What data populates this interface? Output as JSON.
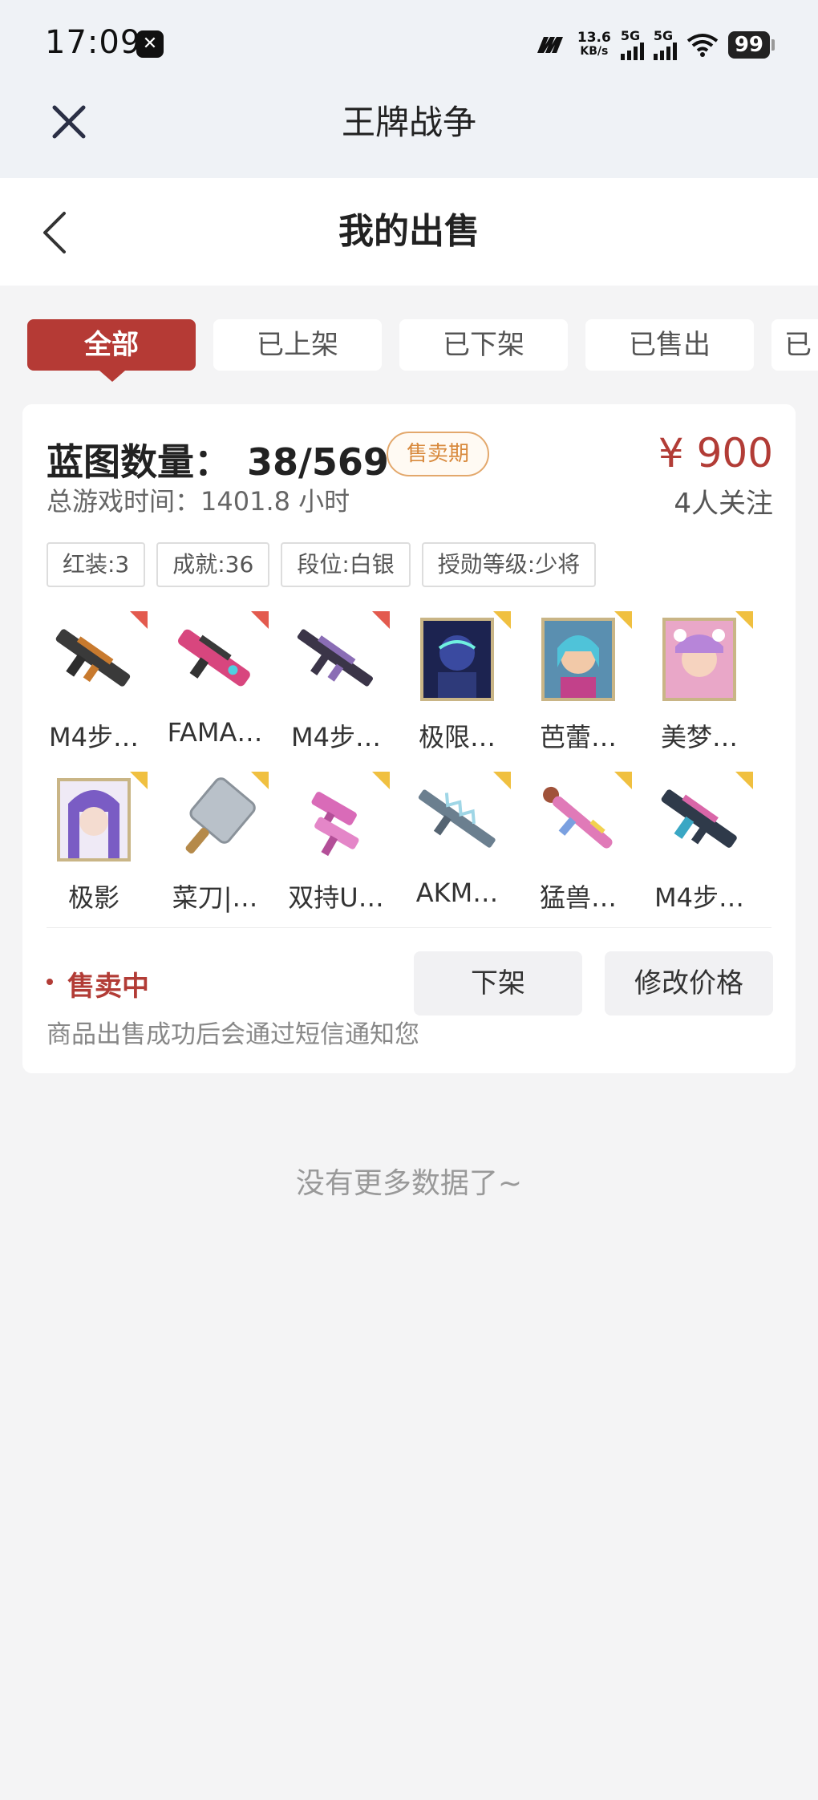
{
  "status_bar": {
    "time": "17:09",
    "net_speed_value": "13.6",
    "net_speed_unit": "KB/s",
    "sim1_label": "5G",
    "sim2_label": "5G",
    "battery": "99"
  },
  "top_bar": {
    "title": "王牌战争"
  },
  "nav": {
    "title": "我的出售"
  },
  "tabs": [
    {
      "label": "全部",
      "active": true
    },
    {
      "label": "已上架"
    },
    {
      "label": "已下架"
    },
    {
      "label": "已售出"
    },
    {
      "label": "已"
    }
  ],
  "listing": {
    "blueprint_label": "蓝图数量：",
    "blueprint_count": "38/569",
    "status_badge": "售卖期",
    "price": "¥ 900",
    "followers": "4人关注",
    "playtime": "总游戏时间：1401.8 小时",
    "tags": [
      "红装:3",
      "成就:36",
      "段位:白银",
      "授勋等级:少将"
    ],
    "items": [
      {
        "name": "M4步…",
        "icon": "rifle-icon",
        "rarity": "red"
      },
      {
        "name": "FAMA…",
        "icon": "rifle-icon",
        "rarity": "red"
      },
      {
        "name": "M4步…",
        "icon": "rifle-icon",
        "rarity": "red"
      },
      {
        "name": "极限…",
        "icon": "character-portrait-icon",
        "rarity": "gold"
      },
      {
        "name": "芭蕾…",
        "icon": "character-portrait-icon",
        "rarity": "gold"
      },
      {
        "name": "美梦…",
        "icon": "character-portrait-icon",
        "rarity": "gold"
      },
      {
        "name": "极影",
        "icon": "character-portrait-icon",
        "rarity": "gold"
      },
      {
        "name": "菜刀|…",
        "icon": "cleaver-icon",
        "rarity": "gold"
      },
      {
        "name": "双持U…",
        "icon": "smg-icon",
        "rarity": "gold"
      },
      {
        "name": "AKM…",
        "icon": "rifle-icon",
        "rarity": "gold"
      },
      {
        "name": "猛兽…",
        "icon": "launcher-icon",
        "rarity": "gold"
      },
      {
        "name": "M4步…",
        "icon": "rifle-icon",
        "rarity": "gold"
      }
    ],
    "sale_status": "售卖中",
    "notice": "商品出售成功后会通过短信通知您",
    "unlist_button": "下架",
    "edit_price_button": "修改价格"
  },
  "footer": {
    "no_more": "没有更多数据了~"
  },
  "colors": {
    "accent": "#b53a35",
    "price": "#b23c36",
    "badge": "#d8893c"
  }
}
